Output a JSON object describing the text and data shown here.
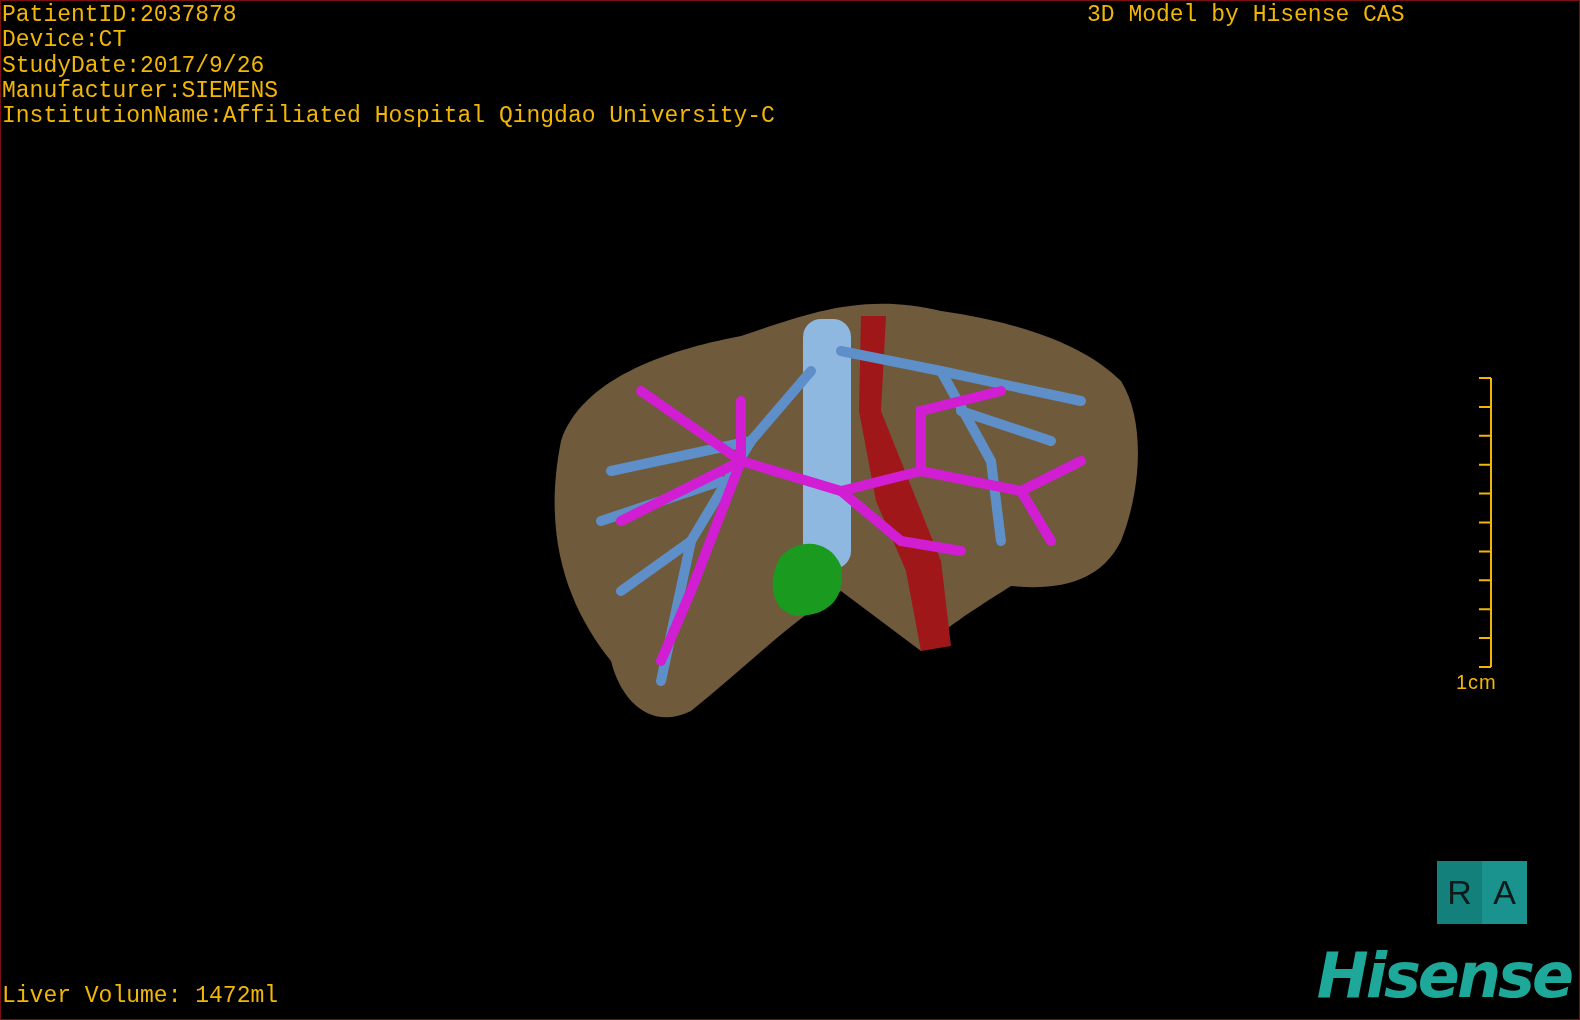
{
  "info_lines": [
    "PatientID:2037878",
    "Device:CT",
    "StudyDate:2017/9/26",
    "Manufacturer:SIEMENS",
    "InstitutionName:Affiliated Hospital Qingdao University-C"
  ],
  "title": "3D Model by Hisense CAS",
  "scale_bar": {
    "label": "1cm"
  },
  "orientation_cube": {
    "left_face": "R",
    "right_face": "A"
  },
  "liver_volume": "Liver Volume: 1472ml",
  "logo": "Hisense"
}
